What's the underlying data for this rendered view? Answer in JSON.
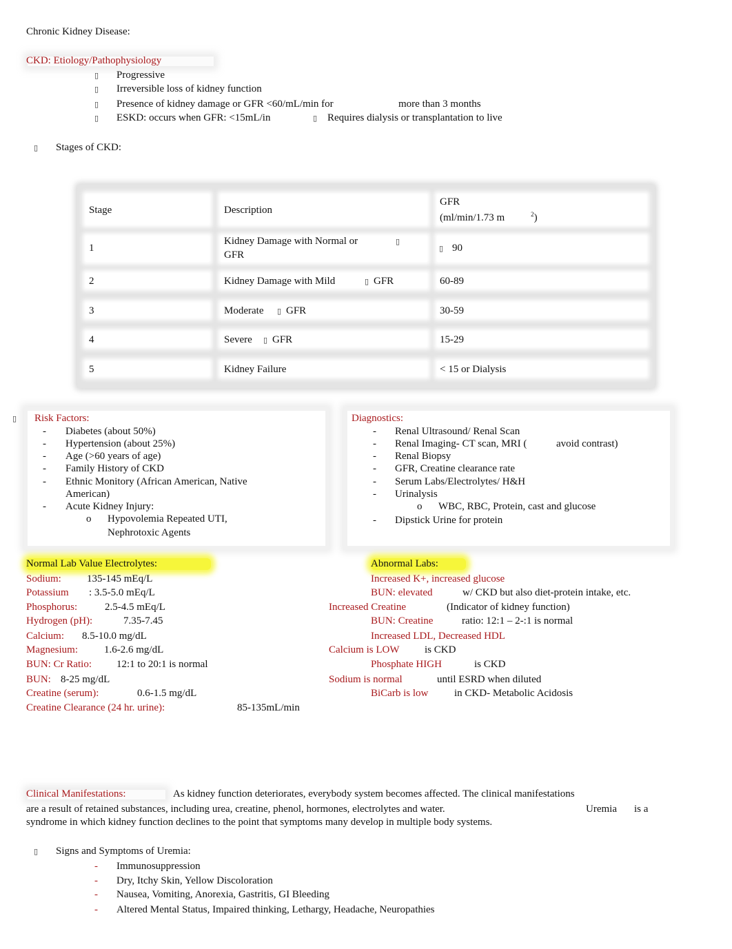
{
  "document": {
    "title": "Chronic Kidney Disease:",
    "etiology": {
      "heading": "CKD: Etiology/Pathophysiology",
      "bullet_glyph": "▯",
      "items": [
        {
          "text": "Progressive"
        },
        {
          "text": "Irreversible loss of kidney function"
        },
        {
          "text": "Presence of kidney damage or GFR <60/mL/min for",
          "text_b": "more than 3 months"
        },
        {
          "text": "ESKD:   occurs when GFR: <15mL/in",
          "text_b": "Requires dialysis or transplantation to live"
        }
      ]
    },
    "stages_heading": "Stages of CKD:",
    "stages_table": {
      "headers": [
        "Stage",
        "Description",
        "GFR",
        "(ml/min/1.73 m",
        "2",
        ")"
      ],
      "rows": [
        {
          "stage": "1",
          "description": "Kidney Damage with Normal or",
          "description_line2": "GFR",
          "desc_glyph": "▯",
          "gfr_glyph": "▯",
          "gfr": "90"
        },
        {
          "stage": "2",
          "description": "Kidney Damage with Mild",
          "desc_glyph": "▯",
          "desc_tail": "GFR",
          "gfr": "60-89"
        },
        {
          "stage": "3",
          "description": "Moderate",
          "desc_glyph": "▯",
          "desc_tail": "GFR",
          "gfr": "30-59"
        },
        {
          "stage": "4",
          "description": "Severe",
          "desc_glyph": "▯",
          "desc_tail": "GFR",
          "gfr": "15-29"
        },
        {
          "stage": "5",
          "description": "Kidney Failure",
          "gfr": "< 15 or Dialysis"
        }
      ]
    },
    "risk_factors": {
      "heading": "Risk Factors:",
      "items": [
        "Diabetes (about 50%)",
        "Hypertension (about 25%)",
        "Age (>60 years of age)",
        "Family History of CKD",
        "Ethnic Monitory (African American, Native",
        "American)",
        "Acute Kidney Injury:"
      ],
      "sub_items": [
        "Hypovolemia Repeated UTI,",
        "Nephrotoxic Agents"
      ],
      "dash": "-",
      "sub_bullet": "o"
    },
    "diagnostics": {
      "heading": "Diagnostics:",
      "items": [
        "Renal Ultrasound/ Renal Scan",
        "Renal Imaging- CT scan, MRI (",
        "Renal Biopsy",
        "GFR, Creatine clearance rate",
        "Serum Labs/Electrolytes/ H&H",
        "Urinalysis",
        "Dipstick Urine for protein"
      ],
      "imaging_tail": "avoid contrast)",
      "sub_item": "WBC, RBC, Protein, cast and glucose"
    },
    "normal_labs": {
      "heading": "Normal Lab Value Electrolytes:",
      "rows": [
        {
          "label": "Sodium:",
          "value": "135-145 mEq/L"
        },
        {
          "label": "Potassium",
          "value": ": 3.5-5.0 mEq/L"
        },
        {
          "label": "Phosphorus:",
          "value": "2.5-4.5 mEq/L"
        },
        {
          "label": "Hydrogen (pH):",
          "value": "7.35-7.45"
        },
        {
          "label": "Calcium:",
          "value": "8.5-10.0 mg/dL"
        },
        {
          "label": "Magnesium:",
          "value": "1.6-2.6 mg/dL"
        },
        {
          "label": "BUN: Cr Ratio:",
          "value": "12:1 to 20:1 is normal"
        },
        {
          "label": "BUN:",
          "value": "8-25 mg/dL"
        },
        {
          "label": "Creatine (serum):",
          "value": "0.6-1.5 mg/dL"
        },
        {
          "label": "Creatine Clearance (24 hr. urine):",
          "value": "85-135mL/min"
        }
      ]
    },
    "abnormal_labs": {
      "heading": "Abnormal Labs:",
      "rows": [
        {
          "label": "Increased K+, increased glucose",
          "value": ""
        },
        {
          "label": "BUN: elevated",
          "value": "w/ CKD but also diet-protein intake, etc."
        },
        {
          "label": "Increased Creatine",
          "value": "(Indicator of kidney function)"
        },
        {
          "label": "BUN: Creatine",
          "value": "ratio: 12:1 – 2-:1 is normal"
        },
        {
          "label": "Increased LDL, Decreased HDL",
          "value": ""
        },
        {
          "label": "Calcium is LOW",
          "value": "is CKD"
        },
        {
          "label": "Phosphate HIGH",
          "value": "is CKD"
        },
        {
          "label": "Sodium is normal",
          "value": "until ESRD when diluted"
        },
        {
          "label": "BiCarb is low",
          "value": "in CKD- Metabolic Acidosis"
        }
      ]
    },
    "clinical": {
      "heading": "Clinical Manifestations:",
      "line1": "As kidney function deteriorates, everybody system becomes affected. The clinical manifestations",
      "line2": "are a result of retained substances, including urea, creatine, phenol, hormones, electrolytes and water.",
      "line2_term": "Uremia",
      "line2_tail": "is a",
      "line3": "syndrome in which kidney function declines to the point that symptoms many develop in multiple body systems."
    },
    "uremia": {
      "heading": "Signs and Symptoms of Uremia:",
      "items": [
        "Immunosuppression",
        "Dry, Itchy Skin, Yellow Discoloration",
        "Nausea, Vomiting, Anorexia, Gastritis, GI Bleeding",
        "Altered Mental Status, Impaired thinking, Lethargy, Headache, Neuropathies"
      ]
    }
  },
  "colors": {
    "accent_red": "#a8191c",
    "highlight_yellow": "#f6f63a",
    "text": "#111111"
  }
}
